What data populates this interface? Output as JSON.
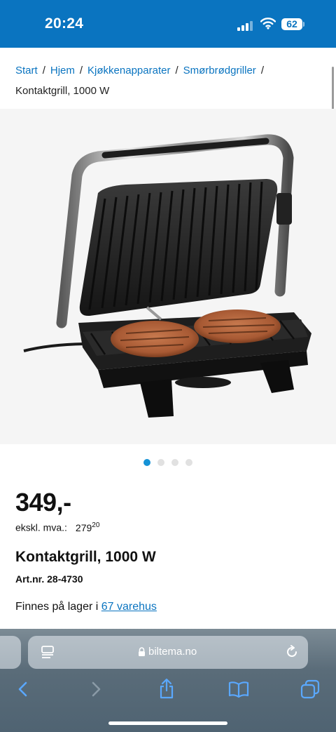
{
  "status": {
    "time": "20:24",
    "battery": "62"
  },
  "breadcrumb": {
    "items": [
      "Start",
      "Hjem",
      "Kjøkkenapparater",
      "Smørbrødgriller"
    ],
    "separator": "/",
    "current": "Kontaktgrill, 1000 W"
  },
  "gallery": {
    "image_count": 4,
    "active_index": 0,
    "product_image": "contact-grill-with-burger-patties"
  },
  "product": {
    "price": "349,-",
    "ex_vat_label": "ekskl. mva.:",
    "ex_vat_main": "279",
    "ex_vat_decimals": "20",
    "title": "Kontaktgrill, 1000 W",
    "article_number": "Art.nr. 28-4730",
    "stock_text": "Finnes på lager i",
    "stock_link": "67 varehus"
  },
  "browser": {
    "url": "biltema.no"
  },
  "colors": {
    "brand_blue": "#0a74c0",
    "dot_active": "#1592d6",
    "image_bg": "#f5f5f5"
  }
}
